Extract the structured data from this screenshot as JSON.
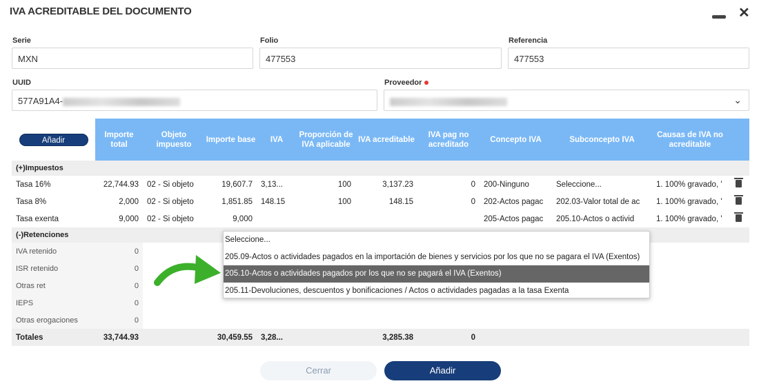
{
  "header": {
    "title": "IVA ACREDITABLE DEL DOCUMENTO"
  },
  "form": {
    "serie": {
      "label": "Serie",
      "value": "MXN"
    },
    "folio": {
      "label": "Folio",
      "value": "477553"
    },
    "referencia": {
      "label": "Referencia",
      "value": "477553"
    },
    "uuid": {
      "label": "UUID",
      "value": "577A91A4-"
    },
    "proveedor": {
      "label": "Proveedor"
    }
  },
  "table": {
    "add_label": "Añadir",
    "columns": [
      "Importe total",
      "Objeto impuesto",
      "Importe base",
      "IVA",
      "Proporción de IVA aplicable",
      "IVA acreditable",
      "IVA pag no acreditado",
      "Concepto IVA",
      "Subconcepto IVA",
      "Causas de IVA no acreditable"
    ],
    "impuestos_label": "(+)Impuestos",
    "rows": [
      {
        "label": "Tasa 16%",
        "total": "22,744.93",
        "objeto": "02 - Si objeto",
        "base": "19,607.7",
        "iva": "3,13...",
        "prop": "100",
        "acred": "3,137.23",
        "nopag": "0",
        "concepto": "200-Ninguno",
        "sub": "Seleccione...",
        "causa": "1. 100% gravado, '"
      },
      {
        "label": "Tasa 8%",
        "total": "2,000",
        "objeto": "02 - Si objeto",
        "base": "1,851.85",
        "iva": "148.15",
        "prop": "100",
        "acred": "148.15",
        "nopag": "0",
        "concepto": "202-Actos pagac",
        "sub": "202.03-Valor total de ac",
        "causa": "1. 100% gravado, '"
      },
      {
        "label": "Tasa exenta",
        "total": "9,000",
        "objeto": "02 - Si objeto",
        "base": "9,000",
        "iva": "",
        "prop": "",
        "acred": "",
        "nopag": "",
        "concepto": "205-Actos pagac",
        "sub": "205.10-Actos o activid",
        "causa": "1. 100% gravado, '"
      }
    ],
    "retenciones_label": "(-)Retenciones",
    "retenciones": [
      {
        "label": "IVA retenido",
        "value": "0"
      },
      {
        "label": "ISR retenido",
        "value": "0"
      },
      {
        "label": "Otras ret",
        "value": "0"
      },
      {
        "label": "IEPS",
        "value": "0"
      },
      {
        "label": "Otras erogaciones",
        "value": "0"
      }
    ],
    "totals": {
      "label": "Totales",
      "total": "33,744.93",
      "base": "30,459.55",
      "iva": "3,28...",
      "acred": "3,285.38",
      "nopag": "0"
    }
  },
  "dropdown": {
    "options": [
      "Seleccione...",
      "205.09-Actos o actividades pagados en la importación de bienes y servicios por los que no se pagara el IVA (Exentos)",
      "205.10-Actos o actividades pagados por los que no se pagará el IVA (Exentos)",
      "205.11-Devoluciones, descuentos y bonificaciones / Actos o actividades pagadas a la tasa Exenta"
    ],
    "selected_index": 2
  },
  "footer": {
    "cancel": "Cerrar",
    "add": "Añadir"
  },
  "colors": {
    "header": "#7ab8f5",
    "primary": "#173e7a",
    "arrow": "#3cb02b"
  }
}
